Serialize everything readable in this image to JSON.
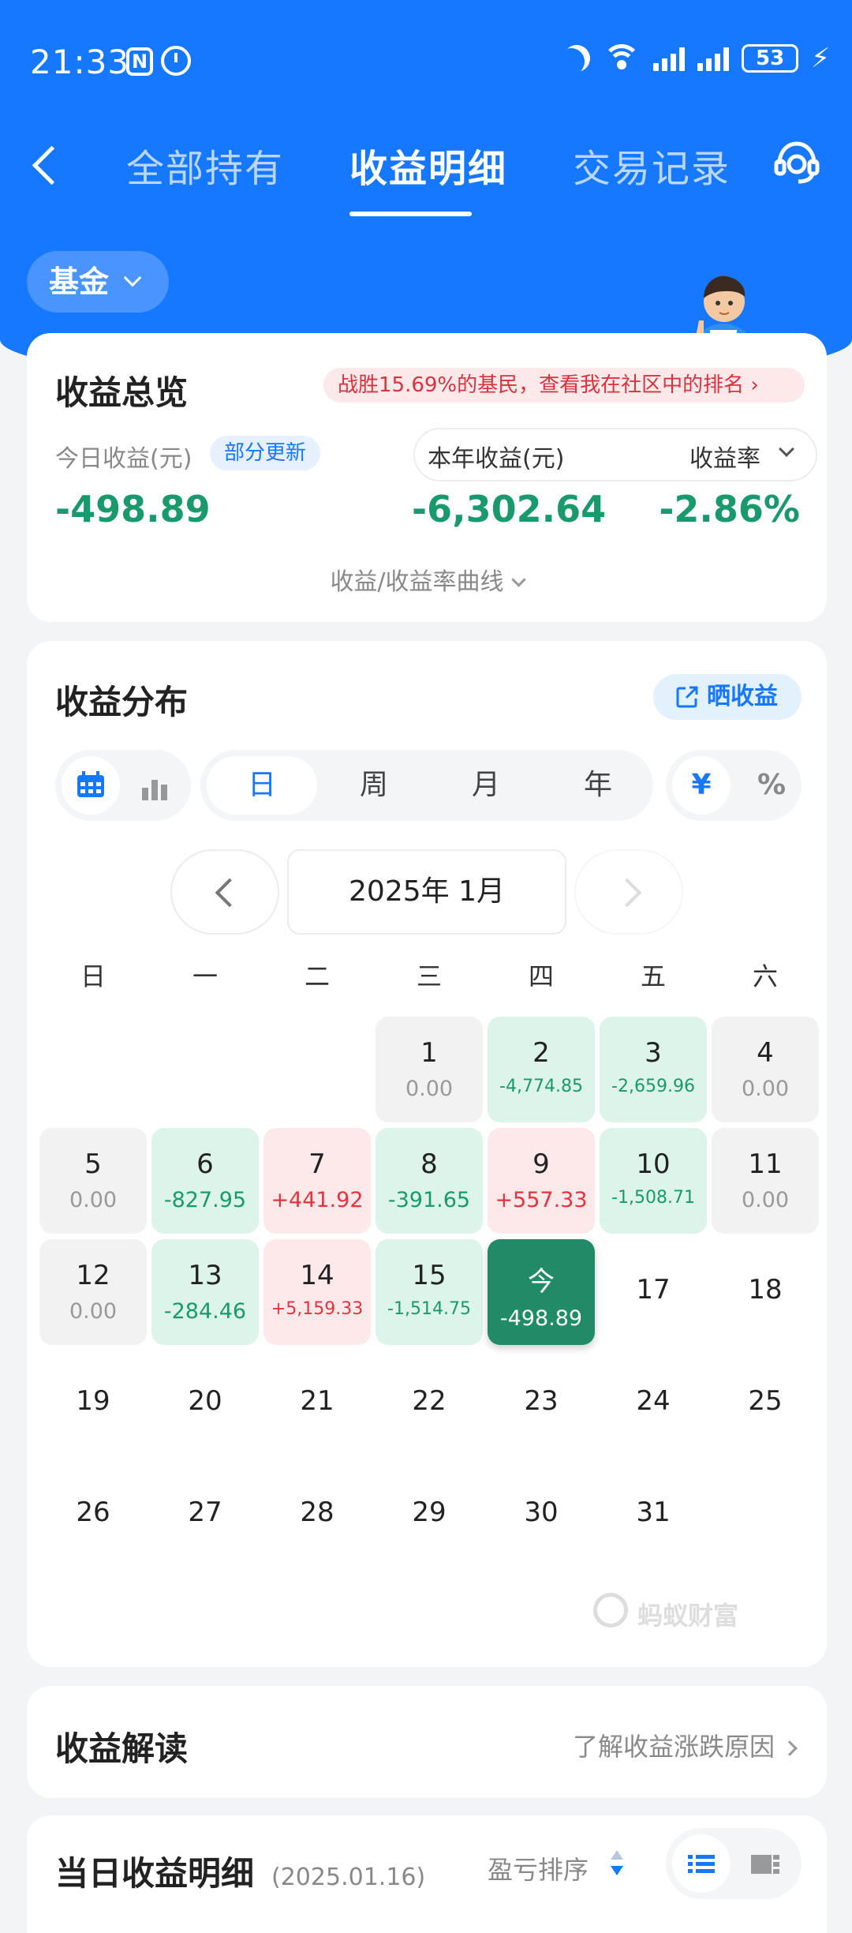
{
  "status_bar": {
    "time": "21:33",
    "nfc": "N",
    "battery": "53"
  },
  "nav": {
    "tabs": [
      {
        "label": "全部持有"
      },
      {
        "label": "收益明细"
      },
      {
        "label": "交易记录"
      }
    ],
    "active_tab": 1
  },
  "filter": {
    "fund_label": "基金"
  },
  "overview": {
    "title": "收益总览",
    "rank_text": "战胜15.69%的基民，查看我在社区中的排名",
    "today_label": "今日收益(元)",
    "partial_badge": "部分更新",
    "today_value": "-498.89",
    "year_label": "本年收益(元)",
    "year_value": "-6,302.64",
    "rate_label": "收益率",
    "rate_value": "-2.86%",
    "curve_link": "收益/收益率曲线"
  },
  "distribution": {
    "title": "收益分布",
    "share_label": "晒收益",
    "periods": [
      "日",
      "周",
      "月",
      "年"
    ],
    "active_period": 0,
    "unit_yuan": "¥",
    "unit_pct": "%",
    "month": "2025年 1月",
    "weekdays": [
      "日",
      "一",
      "二",
      "三",
      "四",
      "五",
      "六"
    ],
    "days": [
      {
        "day": "1",
        "value": "0.00",
        "type": "zero"
      },
      {
        "day": "2",
        "value": "-4,774.85",
        "type": "loss"
      },
      {
        "day": "3",
        "value": "-2,659.96",
        "type": "loss"
      },
      {
        "day": "4",
        "value": "0.00",
        "type": "zero"
      },
      {
        "day": "5",
        "value": "0.00",
        "type": "zero"
      },
      {
        "day": "6",
        "value": "-827.95",
        "type": "loss"
      },
      {
        "day": "7",
        "value": "+441.92",
        "type": "gain"
      },
      {
        "day": "8",
        "value": "-391.65",
        "type": "loss"
      },
      {
        "day": "9",
        "value": "+557.33",
        "type": "gain"
      },
      {
        "day": "10",
        "value": "-1,508.71",
        "type": "loss"
      },
      {
        "day": "11",
        "value": "0.00",
        "type": "zero"
      },
      {
        "day": "12",
        "value": "0.00",
        "type": "zero"
      },
      {
        "day": "13",
        "value": "-284.46",
        "type": "loss"
      },
      {
        "day": "14",
        "value": "+5,159.33",
        "type": "gain"
      },
      {
        "day": "15",
        "value": "-1,514.75",
        "type": "loss"
      },
      {
        "day": "今",
        "value": "-498.89",
        "type": "today"
      },
      {
        "day": "17",
        "value": "",
        "type": "empty"
      },
      {
        "day": "18",
        "value": "",
        "type": "empty"
      },
      {
        "day": "19",
        "value": "",
        "type": "empty"
      },
      {
        "day": "20",
        "value": "",
        "type": "empty"
      },
      {
        "day": "21",
        "value": "",
        "type": "empty"
      },
      {
        "day": "22",
        "value": "",
        "type": "empty"
      },
      {
        "day": "23",
        "value": "",
        "type": "empty"
      },
      {
        "day": "24",
        "value": "",
        "type": "empty"
      },
      {
        "day": "25",
        "value": "",
        "type": "empty"
      },
      {
        "day": "26",
        "value": "",
        "type": "empty"
      },
      {
        "day": "27",
        "value": "",
        "type": "empty"
      },
      {
        "day": "28",
        "value": "",
        "type": "empty"
      },
      {
        "day": "29",
        "value": "",
        "type": "empty"
      },
      {
        "day": "30",
        "value": "",
        "type": "empty"
      },
      {
        "day": "31",
        "value": "",
        "type": "empty"
      }
    ],
    "watermark": "蚂蚁财富"
  },
  "interpretation": {
    "title": "收益解读",
    "link": "了解收益涨跌原因"
  },
  "daily_detail": {
    "title": "当日收益明细",
    "date": "(2025.01.16)",
    "sort_label": "盈亏排序"
  },
  "colors": {
    "brand_blue": "#1677ff",
    "loss_green": "#1a9a6c",
    "gain_red": "#e0343e",
    "today_green": "#218a66"
  }
}
